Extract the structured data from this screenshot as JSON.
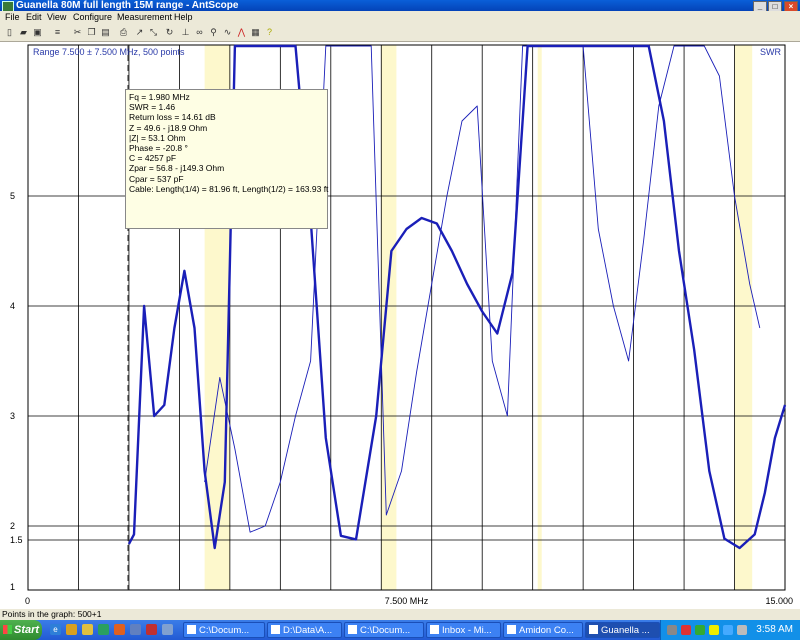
{
  "window": {
    "title": "Guanella 80M full length 15M range - AntScope",
    "buttons": [
      "_",
      "□",
      "×"
    ]
  },
  "menu": [
    "File",
    "Edit",
    "View",
    "Configure",
    "Measurement",
    "Help"
  ],
  "toolbar_icons": [
    "new-icon",
    "open-icon",
    "save-icon",
    "props-icon",
    "cut-icon",
    "copy-icon",
    "paste-icon",
    "undo-icon",
    "refresh-icon",
    "print-icon",
    "scan-icon",
    "zoom-icon",
    "loop-icon",
    "measure-icon",
    "bold-icon",
    "filter-icon",
    "freq-icon",
    "chart-icon",
    "help-icon"
  ],
  "plot": {
    "range_label": "Range  7.500 ± 7.500 MHz, 500 points",
    "y_label": "SWR",
    "y_ticks": [
      "5",
      "4",
      "3",
      "2",
      "1.5",
      "1"
    ],
    "x_ticks": [
      "0",
      "7.500 MHz",
      "15.000"
    ]
  },
  "chart_data": {
    "type": "line",
    "xlim": [
      0,
      15.0
    ],
    "ylim": [
      1,
      6
    ],
    "highlight_bands_mhz": [
      [
        3.5,
        4.0
      ],
      [
        7.0,
        7.3
      ],
      [
        10.1,
        10.15
      ],
      [
        14.0,
        14.35
      ]
    ],
    "series": [
      {
        "style": "thick",
        "x": [
          2.0,
          2.1,
          2.3,
          2.5,
          2.7,
          2.9,
          3.1,
          3.3,
          3.5,
          3.7,
          3.9,
          4.1,
          4.3,
          4.5,
          4.7,
          5.0,
          5.3,
          5.6,
          5.9,
          6.2,
          6.5,
          6.9,
          7.2,
          7.5,
          7.8,
          8.1,
          8.4,
          8.7,
          9.0,
          9.3,
          9.6,
          9.9,
          10.2,
          10.5,
          10.8,
          11.1,
          11.4,
          11.7,
          12.0,
          12.3,
          12.6,
          12.9,
          13.2,
          13.5,
          13.8,
          14.1,
          14.4,
          14.6,
          14.8,
          15.0
        ],
        "y": [
          1.46,
          1.7,
          4.0,
          3.0,
          3.1,
          3.8,
          4.32,
          3.8,
          2.5,
          1.42,
          2.4,
          6.0,
          6.0,
          6.0,
          6.0,
          6.0,
          6.0,
          4.8,
          2.8,
          1.65,
          1.52,
          3.0,
          4.5,
          4.7,
          4.8,
          4.75,
          4.5,
          4.2,
          3.95,
          3.75,
          4.3,
          6.0,
          6.0,
          6.0,
          6.0,
          6.0,
          6.0,
          6.0,
          6.0,
          6.0,
          5.5,
          4.5,
          3.6,
          2.5,
          1.55,
          1.42,
          1.7,
          2.3,
          2.8,
          3.1
        ]
      },
      {
        "style": "thin",
        "x": [
          3.5,
          3.8,
          4.1,
          4.4,
          4.7,
          5.0,
          5.3,
          5.6,
          5.9,
          6.2,
          6.5,
          6.8,
          7.1,
          7.4,
          7.7,
          8.0,
          8.3,
          8.6,
          8.9,
          9.2,
          9.5,
          9.8,
          10.1,
          10.4,
          10.7,
          11.0,
          11.3,
          11.6,
          11.9,
          12.2,
          12.5,
          12.8,
          13.1,
          13.4,
          13.7,
          14.0,
          14.3,
          14.5
        ],
        "y": [
          2.4,
          3.35,
          2.7,
          1.78,
          2.0,
          2.4,
          3.0,
          3.5,
          6.0,
          6.0,
          6.0,
          6.0,
          2.1,
          2.5,
          3.4,
          4.2,
          5.0,
          5.5,
          5.6,
          3.5,
          3.0,
          6.0,
          6.0,
          6.0,
          6.0,
          6.0,
          4.7,
          4.0,
          3.5,
          4.6,
          5.6,
          6.0,
          6.0,
          6.0,
          5.8,
          5.0,
          4.2,
          3.8
        ]
      }
    ],
    "cursor_x": 1.98
  },
  "info_box": {
    "lines": [
      "Fq = 1.980 MHz",
      "SWR = 1.46",
      "Return loss = 14.61 dB",
      "Z = 49.6 - j18.9 Ohm",
      "|Z| = 53.1 Ohm",
      "Phase = -20.8 °",
      "C = 4257 pF",
      "Zpar = 56.8 - j149.3 Ohm",
      "Cpar = 537 pF",
      "Cable: Length(1/4) = 81.96 ft, Length(1/2) = 163.93 ft"
    ]
  },
  "status": {
    "text": "Points in the graph: 500+1"
  },
  "taskbar": {
    "start_label": "Start",
    "tasks": [
      "C:\\Docum...",
      "D:\\Data\\A...",
      "C:\\Docum...",
      "Inbox - Mi...",
      "Amidon Co...",
      "Guanella ..."
    ],
    "clock": "3:58 AM"
  }
}
